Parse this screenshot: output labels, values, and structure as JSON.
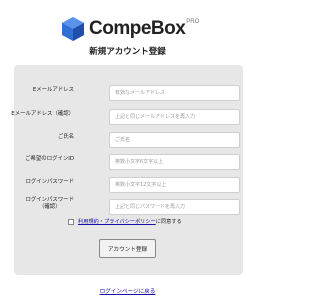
{
  "logo": {
    "name": "CompeBox",
    "suffix": "PRO"
  },
  "page_title": "新規アカウント登録",
  "form": {
    "fields": [
      {
        "label": "Eメールアドレス",
        "sublabel": "",
        "placeholder": "有効なメールアドレス"
      },
      {
        "label": "Eメールアドレス（確認）",
        "sublabel": "",
        "placeholder": "上記と同じメールアドレスを再入力"
      },
      {
        "label": "ご氏名",
        "sublabel": "",
        "placeholder": "ご氏名"
      },
      {
        "label": "ご希望のログインID",
        "sublabel": "",
        "placeholder": "英数小文字6文字以上"
      },
      {
        "label": "ログインパスワード",
        "sublabel": "",
        "placeholder": "英数小文字12文字以上"
      },
      {
        "label": "ログインパスワード",
        "sublabel": "（確認）",
        "placeholder": "上記と同じパスワードを再入力"
      }
    ],
    "agree_link": "利用規約・プライバシーポリシー",
    "agree_text": "に同意する",
    "submit_label": "アカウント登録"
  },
  "footer": {
    "login_link": "ログインページに戻る"
  },
  "colors": {
    "panel": "#e7e7e7",
    "link": "#1a0dab",
    "logo_hex": "#2f6fd6"
  }
}
